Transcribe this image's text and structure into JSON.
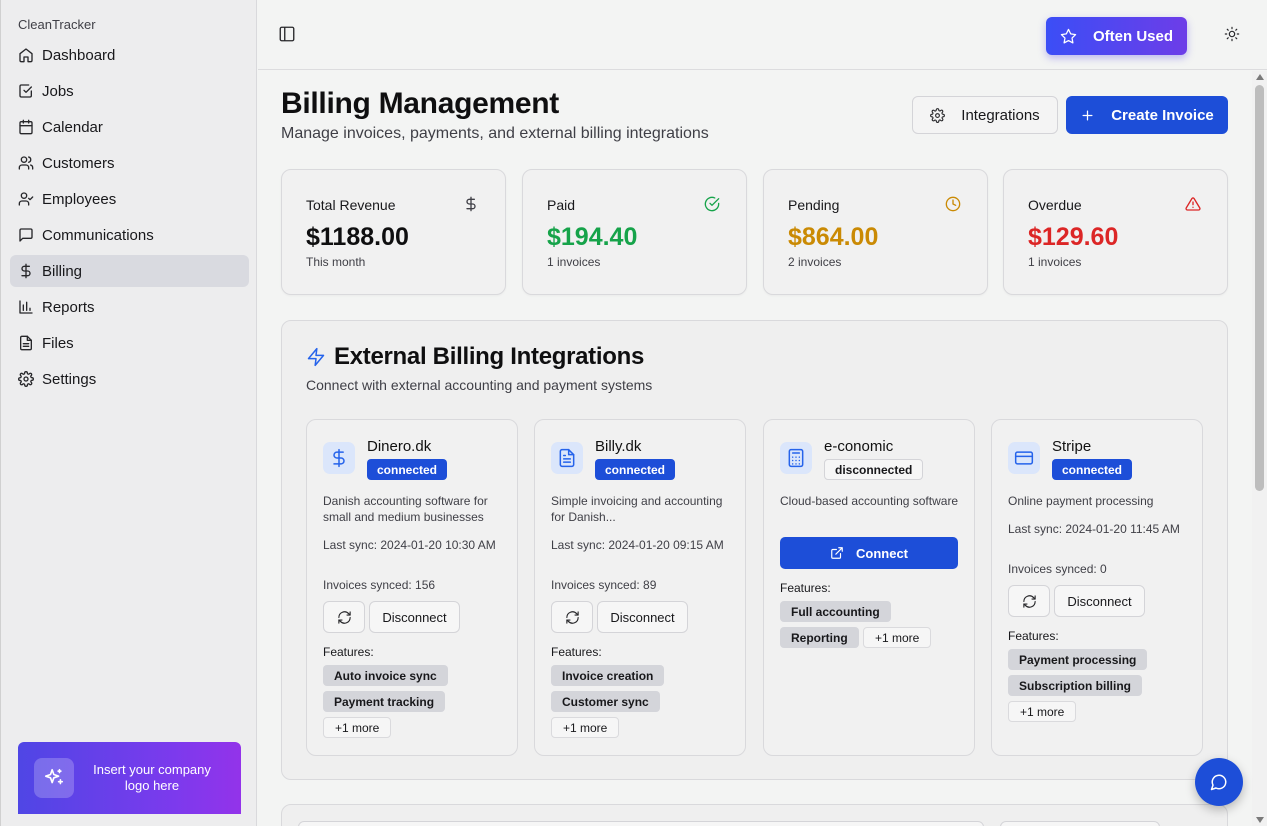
{
  "app": {
    "brand": "CleanTracker"
  },
  "sidebar": {
    "items": [
      {
        "label": "Dashboard",
        "icon": "home-icon"
      },
      {
        "label": "Jobs",
        "icon": "checkbox-icon"
      },
      {
        "label": "Calendar",
        "icon": "calendar-icon"
      },
      {
        "label": "Customers",
        "icon": "users-icon"
      },
      {
        "label": "Employees",
        "icon": "user-check-icon"
      },
      {
        "label": "Communications",
        "icon": "message-icon"
      },
      {
        "label": "Billing",
        "icon": "dollar-icon",
        "active": true
      },
      {
        "label": "Reports",
        "icon": "bar-chart-icon"
      },
      {
        "label": "Files",
        "icon": "file-icon"
      },
      {
        "label": "Settings",
        "icon": "gear-icon"
      }
    ],
    "promo_text": "Insert your company logo here"
  },
  "topbar": {
    "often_used_label": "Often Used"
  },
  "page": {
    "title": "Billing Management",
    "subtitle": "Manage invoices, payments, and external billing integrations",
    "integrations_button": "Integrations",
    "create_button": "Create Invoice"
  },
  "stats": [
    {
      "label": "Total Revenue",
      "value": "$1188.00",
      "sub": "This month",
      "color": "#0f0f10",
      "icon": "dollar-icon"
    },
    {
      "label": "Paid",
      "value": "$194.40",
      "sub": "1 invoices",
      "color": "#16a34a",
      "icon": "check-circle-icon"
    },
    {
      "label": "Pending",
      "value": "$864.00",
      "sub": "2 invoices",
      "color": "#ca8a04",
      "icon": "clock-icon"
    },
    {
      "label": "Overdue",
      "value": "$129.60",
      "sub": "1 invoices",
      "color": "#dc2626",
      "icon": "alert-triangle-icon"
    }
  ],
  "integrations": {
    "title": "External Billing Integrations",
    "subtitle": "Connect with external accounting and payment systems",
    "features_label": "Features:",
    "disconnect_label": "Disconnect",
    "connect_label": "Connect",
    "cards": [
      {
        "name": "Dinero.dk",
        "status": "connected",
        "icon": "dollar-icon",
        "desc": "Danish accounting software for small and medium businesses",
        "last_sync": "Last sync: 2024-01-20 10:30 AM",
        "invoices_synced": "Invoices synced: 156",
        "features": [
          "Auto invoice sync",
          "Payment tracking"
        ],
        "more": "+1 more"
      },
      {
        "name": "Billy.dk",
        "status": "connected",
        "icon": "file-text-icon",
        "desc": "Simple invoicing and accounting for Danish...",
        "last_sync": "Last sync: 2024-01-20 09:15 AM",
        "invoices_synced": "Invoices synced: 89",
        "features": [
          "Invoice creation",
          "Customer sync"
        ],
        "more": "+1 more"
      },
      {
        "name": "e-conomic",
        "status": "disconnected",
        "icon": "calculator-icon",
        "desc": "Cloud-based accounting software",
        "features": [
          "Full accounting",
          "Reporting"
        ],
        "more": "+1 more"
      },
      {
        "name": "Stripe",
        "status": "connected",
        "icon": "credit-card-icon",
        "desc": "Online payment processing",
        "last_sync": "Last sync: 2024-01-20 11:45 AM",
        "invoices_synced": "Invoices synced: 0",
        "features": [
          "Payment processing",
          "Subscription billing"
        ],
        "more": "+1 more"
      }
    ]
  }
}
